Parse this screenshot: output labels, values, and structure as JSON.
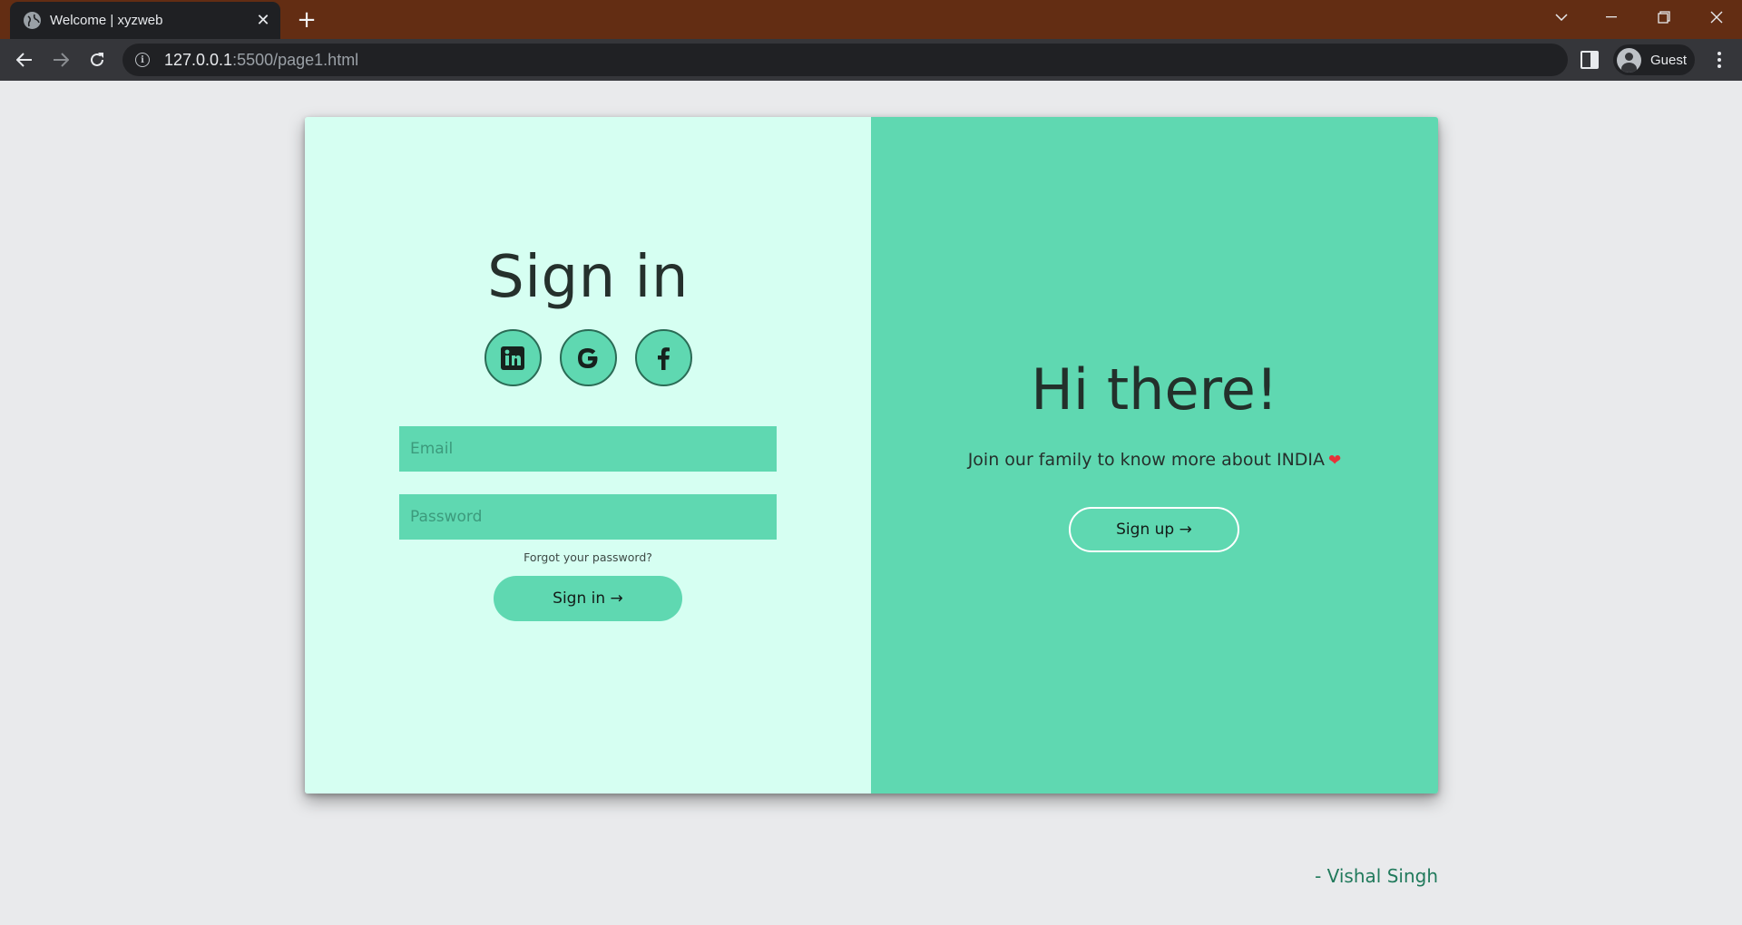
{
  "browser": {
    "tab_title": "Welcome | xyzweb",
    "url_host": "127.0.0.1",
    "url_rest": ":5500/page1.html",
    "profile_name": "Guest"
  },
  "signin": {
    "title": "Sign in",
    "social_icons": [
      "linkedin-icon",
      "google-icon",
      "facebook-icon"
    ],
    "email_placeholder": "Email",
    "email_value": "",
    "password_placeholder": "Password",
    "password_value": "",
    "forgot_label": "Forgot your password?",
    "button_label": "Sign in →"
  },
  "welcome": {
    "title": "Hi there!",
    "subtitle": "Join our family to know more about INDIA",
    "heart": "❤",
    "button_label": "Sign up →"
  },
  "footer": {
    "author": "- Vishal Singh"
  },
  "colors": {
    "panel_light": "#d6fff2",
    "accent": "#5fd8b1",
    "page_bg": "#e9eaec",
    "tabbar_bg": "#632d13"
  }
}
